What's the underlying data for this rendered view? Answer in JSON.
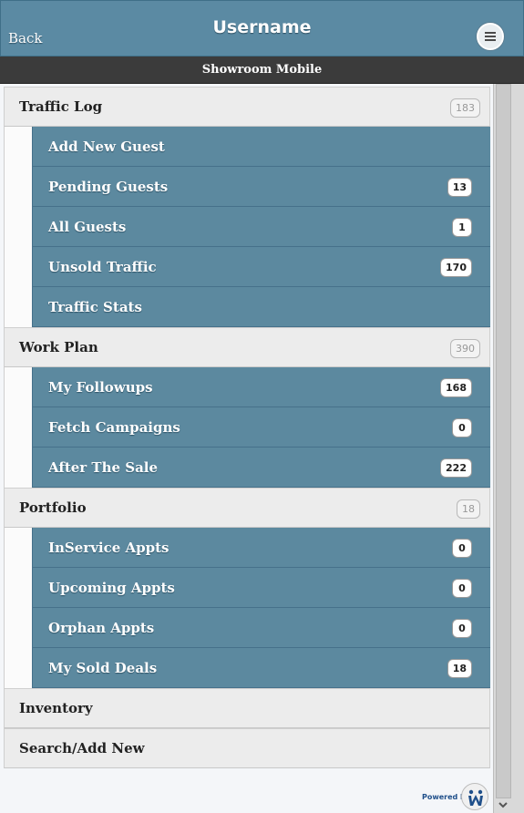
{
  "header": {
    "back_label": "Back",
    "title": "Username",
    "menu_icon": "hamburger-menu-icon"
  },
  "subheader": {
    "text": "Showroom Mobile"
  },
  "sections": [
    {
      "label": "Traffic Log",
      "count": "183",
      "items": [
        {
          "label": "Add New Guest",
          "count": ""
        },
        {
          "label": "Pending Guests",
          "count": "13"
        },
        {
          "label": "All Guests",
          "count": "1"
        },
        {
          "label": "Unsold Traffic",
          "count": "170"
        },
        {
          "label": "Traffic Stats",
          "count": ""
        }
      ]
    },
    {
      "label": "Work Plan",
      "count": "390",
      "items": [
        {
          "label": "My Followups",
          "count": "168"
        },
        {
          "label": "Fetch Campaigns",
          "count": "0"
        },
        {
          "label": "After The Sale",
          "count": "222"
        }
      ]
    },
    {
      "label": "Portfolio",
      "count": "18",
      "items": [
        {
          "label": "InService Appts",
          "count": "0"
        },
        {
          "label": "Upcoming Appts",
          "count": "0"
        },
        {
          "label": "Orphan Appts",
          "count": "0"
        },
        {
          "label": "My Sold Deals",
          "count": "18"
        }
      ]
    },
    {
      "label": "Inventory",
      "count": ""
    },
    {
      "label": "Search/Add New",
      "count": ""
    }
  ],
  "footer": {
    "powered_by": "Powered by",
    "logo_icon": "mi-logo-icon"
  },
  "colors": {
    "header_bg": "#5b8aa3",
    "subbar_bg": "#3b3b3b",
    "item_bg": "#5c899f",
    "section_bg": "#ececec"
  }
}
